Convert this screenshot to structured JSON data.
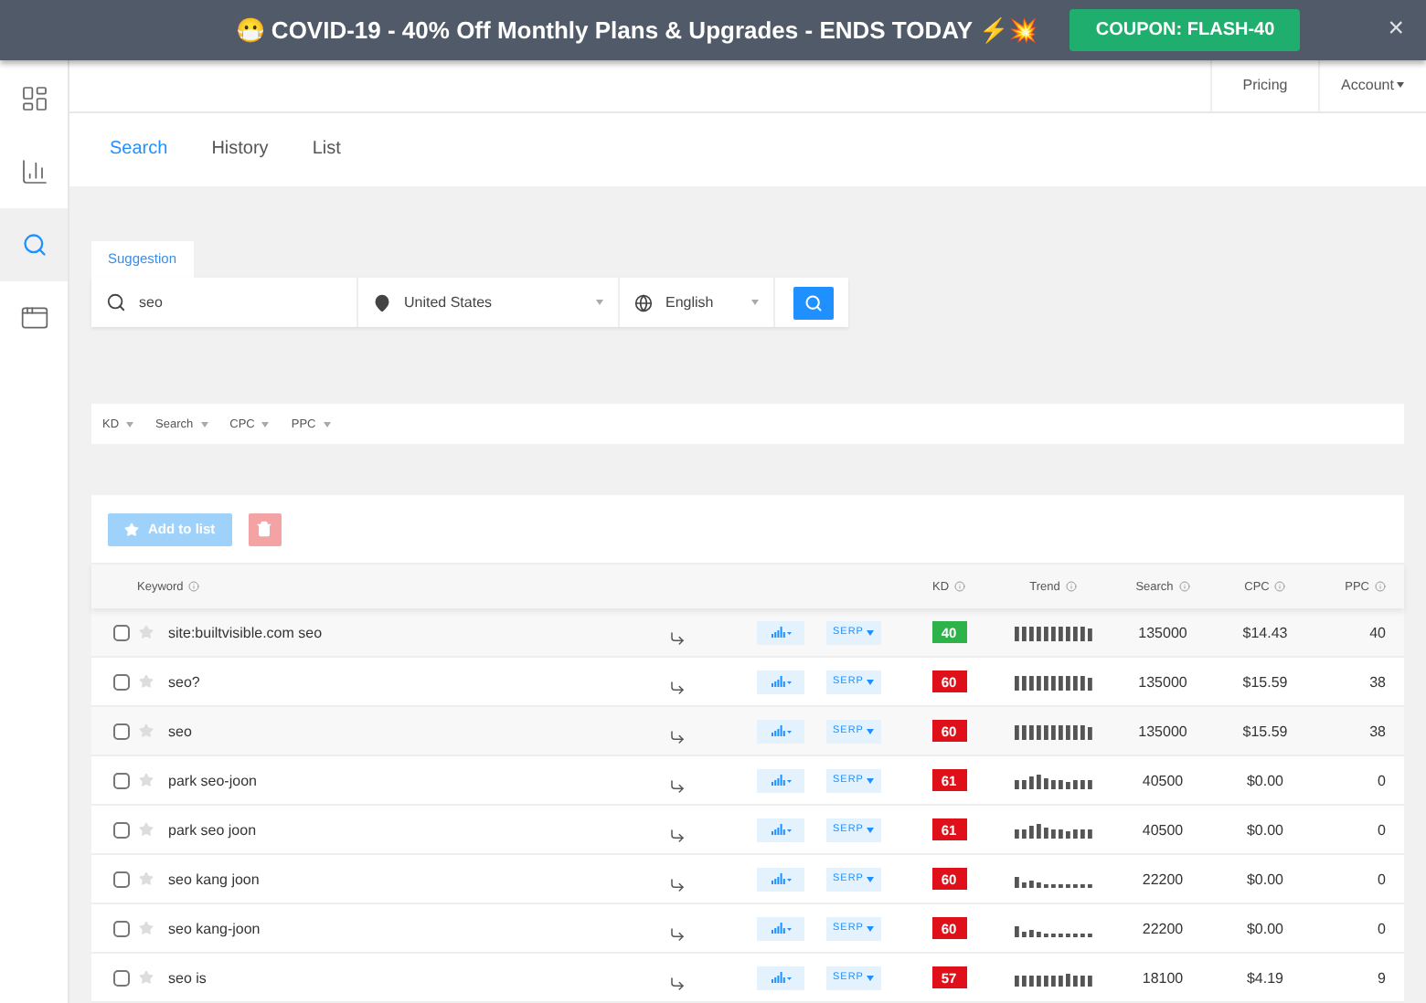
{
  "banner": {
    "text": "😷 COVID-19 - 40% Off Monthly Plans & Upgrades - ENDS TODAY ⚡💥",
    "coupon": "COUPON: FLASH-40",
    "close": "×"
  },
  "sidebar": {
    "items": [
      {
        "kind": "dashboard",
        "selected": false
      },
      {
        "kind": "chart",
        "selected": false
      },
      {
        "kind": "search",
        "selected": true
      },
      {
        "kind": "window",
        "selected": false
      }
    ]
  },
  "header": {
    "links": [
      "Pricing",
      "Account"
    ]
  },
  "tabs": [
    {
      "label": "Search",
      "selected": true
    },
    {
      "label": "History",
      "selected": false
    },
    {
      "label": "List",
      "selected": false
    }
  ],
  "search_panel": {
    "tabs": [
      {
        "label": "Suggestion",
        "selected": true
      }
    ],
    "keyword": "seo",
    "country": "United States",
    "language": "English"
  },
  "filters": [
    "KD",
    "Search",
    "CPC",
    "PPC"
  ],
  "toolbar": {
    "add_to_list": "Add to list"
  },
  "table": {
    "columns": [
      "Keyword",
      "KD",
      "Trend",
      "Search",
      "CPC",
      "PPC"
    ],
    "rows": [
      {
        "keyword": "site:builtvisible.com seo",
        "checked": false,
        "starred": false,
        "serp": "SERP",
        "kd": "40",
        "color": "#2db34a",
        "search": "135000",
        "cpc": "$14.43",
        "ppc": "40"
      },
      {
        "keyword": "seo?",
        "checked": false,
        "starred": false,
        "serp": "SERP",
        "kd": "60",
        "color": "#e0101a",
        "search": "135000",
        "cpc": "$15.59",
        "ppc": "38"
      },
      {
        "keyword": "seo",
        "checked": false,
        "starred": false,
        "serp": "SERP",
        "kd": "60",
        "color": "#e0101a",
        "search": "135000",
        "cpc": "$15.59",
        "ppc": "38"
      },
      {
        "keyword": "park seo-joon",
        "checked": false,
        "starred": false,
        "serp": "SERP",
        "kd": "61",
        "color": "#e0101a",
        "search": "40500",
        "cpc": "$0.00",
        "ppc": "0"
      },
      {
        "keyword": "park seo joon",
        "checked": false,
        "starred": false,
        "serp": "SERP",
        "kd": "61",
        "color": "#e0101a",
        "search": "40500",
        "cpc": "$0.00",
        "ppc": "0"
      },
      {
        "keyword": "seo kang joon",
        "checked": false,
        "starred": false,
        "serp": "SERP",
        "kd": "60",
        "color": "#e0101a",
        "search": "22200",
        "cpc": "$0.00",
        "ppc": "0"
      },
      {
        "keyword": "seo kang-joon",
        "checked": false,
        "starred": false,
        "serp": "SERP",
        "kd": "60",
        "color": "#e0101a",
        "search": "22200",
        "cpc": "$0.00",
        "ppc": "0"
      },
      {
        "keyword": "seo is",
        "checked": false,
        "starred": false,
        "serp": "SERP",
        "kd": "57",
        "color": "#e0101a",
        "search": "18100",
        "cpc": "$4.19",
        "ppc": "9"
      }
    ]
  }
}
